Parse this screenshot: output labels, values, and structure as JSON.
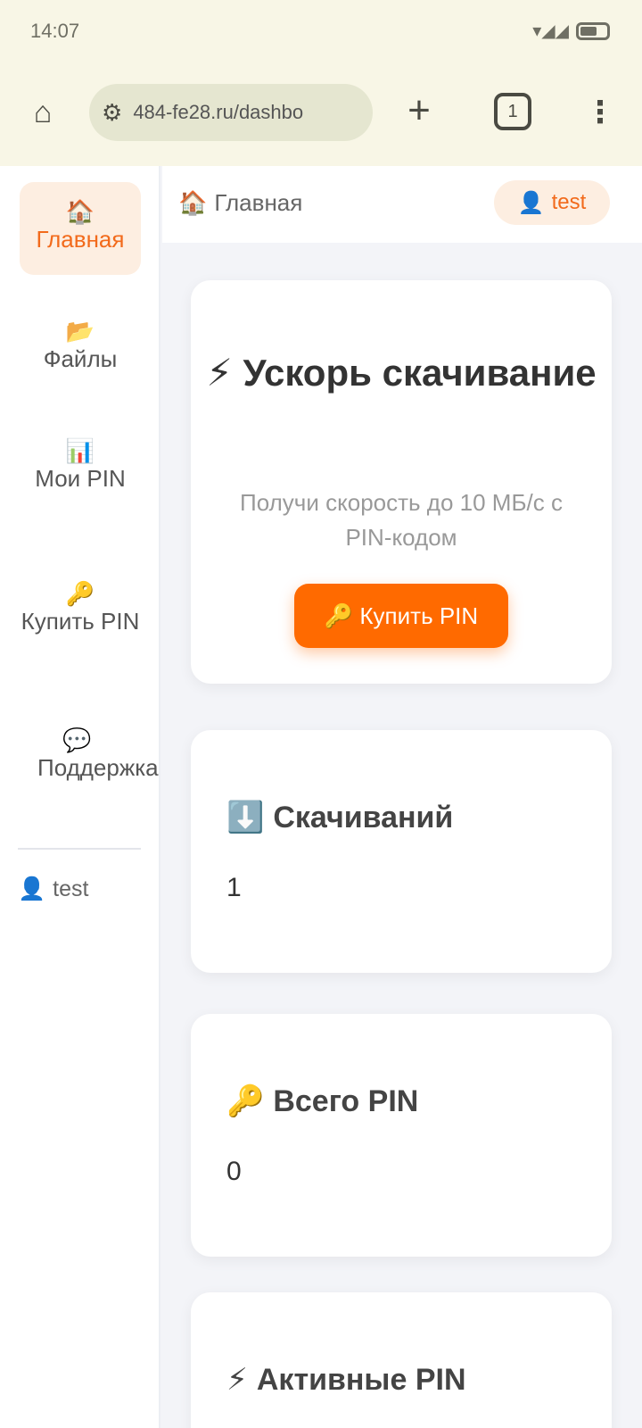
{
  "status_bar": {
    "time": "14:07",
    "signal": "▾◢◢"
  },
  "browser": {
    "home_icon": "home-icon",
    "url": "484-fe28.ru/dashbo",
    "site_icon": "site-settings-icon",
    "new_tab": "+",
    "tabs_count": "1",
    "menu": "⋮"
  },
  "sidebar": {
    "items": [
      {
        "icon": "🏠",
        "label": "Главная",
        "active": true
      },
      {
        "icon": "📂",
        "label": "Файлы",
        "active": false
      },
      {
        "icon": "📊",
        "label": "Мои PIN",
        "active": false
      },
      {
        "icon": "🔑",
        "label": "Купить PIN",
        "active": false
      },
      {
        "icon": "💬",
        "label": "Поддержка",
        "active": false
      }
    ],
    "user": {
      "icon": "👤",
      "name": "test"
    }
  },
  "topbar": {
    "breadcrumb": {
      "icon": "🏠",
      "label": "Главная"
    },
    "user_chip": {
      "icon": "👤",
      "name": "test"
    }
  },
  "hero": {
    "title": "⚡ Ускорь скачивание",
    "subtitle": "Получи скорость до 10 МБ/с с PIN-кодом",
    "button": "🔑 Купить PIN"
  },
  "stats": [
    {
      "icon": "⬇️",
      "title": "Скачиваний",
      "value": "1"
    },
    {
      "icon": "🔑",
      "title": "Всего PIN",
      "value": "0"
    },
    {
      "icon": "⚡",
      "title": "Активные PIN",
      "value": ""
    }
  ],
  "colors": {
    "accent": "#ff6a00",
    "active_bg": "#fdeee1",
    "page_bg": "#f3f4f8",
    "chrome_bg": "#f8f6e6"
  }
}
